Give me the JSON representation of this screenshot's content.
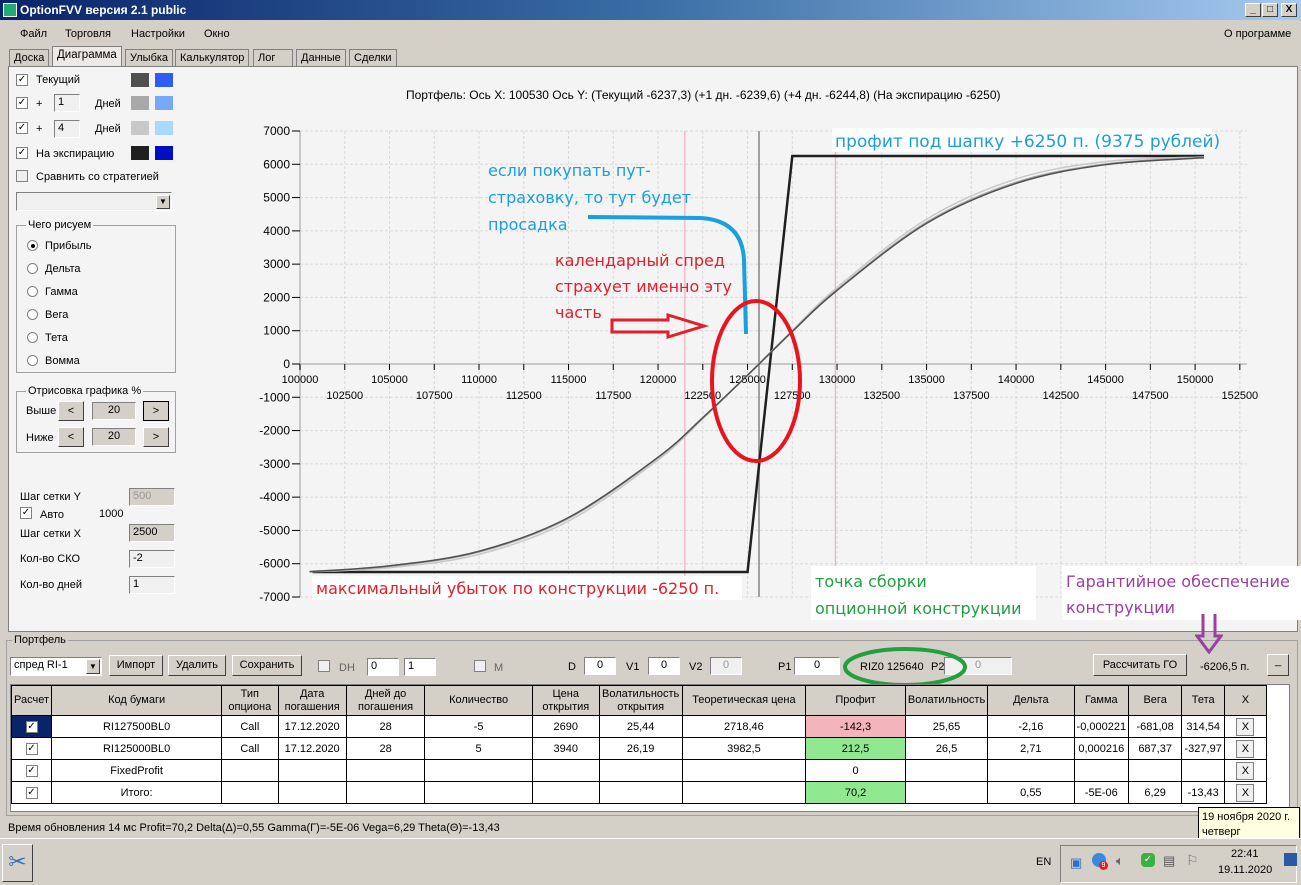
{
  "window": {
    "title": "OptionFVV версия 2.1 public",
    "controls": [
      "_",
      "□",
      "X"
    ]
  },
  "menu": {
    "items": [
      "Файл",
      "Торговля",
      "Настройки",
      "Окно"
    ],
    "about": "О программе"
  },
  "tabs": [
    "Доска",
    "Диаграмма",
    "Улыбка",
    "Калькулятор",
    "Лог",
    "Данные",
    "Сделки"
  ],
  "active_tab": "Диаграмма",
  "left": {
    "current": {
      "label": "Текущий",
      "checked": true,
      "colors": [
        "#505050",
        "#2f5cf5"
      ]
    },
    "plus1": {
      "prefix": "+",
      "value": "1",
      "unit": "Дней",
      "checked": true,
      "colors": [
        "#a8a8a8",
        "#78a8f8"
      ]
    },
    "plus4": {
      "prefix": "+",
      "value": "4",
      "unit": "Дней",
      "checked": true,
      "colors": [
        "#c8c8c8",
        "#a8d8fc"
      ]
    },
    "expiry": {
      "label": "На экспирацию",
      "checked": true,
      "colors": [
        "#202020",
        "#0010c0"
      ]
    },
    "compare": {
      "label": "Сравнить со стратегией",
      "checked": false
    },
    "strategy_select": "",
    "what_group": "Чего рисуем",
    "what_options": [
      "Прибыль",
      "Дельта",
      "Гамма",
      "Вега",
      "Тета",
      "Вомма"
    ],
    "what_selected": "Прибыль",
    "draw_group": "Отрисовка графика %",
    "above_label": "Выше",
    "above_value": "20",
    "below_label": "Ниже",
    "below_value": "20",
    "prev": "<",
    "next": ">",
    "grid_y_label": "Шаг сетки Y",
    "grid_y_value": "500",
    "auto_label": "Авто",
    "auto_checked": true,
    "auto_value": "1000",
    "grid_x_label": "Шаг сетки X",
    "grid_x_value": "2500",
    "sko_label": "Кол-во СКО",
    "sko_value": "-2",
    "days_label": "Кол-во дней",
    "days_value": "1"
  },
  "chart_header": "Портфель: Ось X: 100530 Ось Y:  (Текущий -6237,3)  (+1 дн. -6239,6)  (+4 дн. -6244,8)  (На экспирацию -6250)",
  "chart_data": {
    "type": "line",
    "xlim": [
      100000,
      152900
    ],
    "ylim": [
      -7000,
      7000
    ],
    "grid": true,
    "yticks": [
      7000,
      6000,
      5000,
      4000,
      3000,
      2000,
      1000,
      0,
      -1000,
      -2000,
      -3000,
      -4000,
      -5000,
      -6000,
      -7000
    ],
    "xticks_upper": [
      100000,
      105000,
      110000,
      115000,
      120000,
      125000,
      130000,
      135000,
      140000,
      145000,
      150000
    ],
    "xticks_lower": [
      102500,
      107500,
      112500,
      117500,
      122500,
      127500,
      132500,
      137500,
      142500,
      147500,
      152500
    ],
    "vlines": [
      {
        "x": 125640,
        "color": "#a0a0a0"
      },
      {
        "x": 121500,
        "color": "#f0a0b0"
      },
      {
        "x": 129900,
        "color": "#f0a0b0"
      }
    ],
    "x": [
      100530,
      105000,
      110000,
      115000,
      120000,
      122500,
      125000,
      127500,
      130000,
      135000,
      140000,
      145000,
      150500
    ],
    "series": [
      {
        "name": "Текущий",
        "color": "#505050",
        "values": [
          -6237,
          -6062,
          -5625,
          -4612,
          -2800,
          -1612,
          -338,
          975,
          2212,
          4225,
          5425,
          5988,
          6195
        ]
      },
      {
        "name": "+1 дн.",
        "color": "#a8a8a8",
        "values": [
          -6240,
          -6080,
          -5650,
          -4640,
          -2820,
          -1620,
          -335,
          985,
          2235,
          4260,
          5460,
          6010,
          6205
        ]
      },
      {
        "name": "+4 дн.",
        "color": "#c8c8c8",
        "values": [
          -6245,
          -6120,
          -5720,
          -4720,
          -2880,
          -1650,
          -330,
          1010,
          2300,
          4350,
          5560,
          6080,
          6220
        ]
      },
      {
        "name": "На экспирацию",
        "color": "#202020",
        "points": [
          [
            100700,
            -6250
          ],
          [
            125000,
            -6250
          ],
          [
            127500,
            6250
          ],
          [
            150500,
            6250
          ]
        ]
      }
    ]
  },
  "annotations": {
    "profit_cap": "профит под шапку +6250 п. (9375 рублей)",
    "put_lines": [
      "если покупать пут-",
      "страховку, то тут будет",
      "просадка"
    ],
    "calendar_lines": [
      "календарный спред",
      "страхует именно эту",
      "часть"
    ],
    "max_loss": "максимальный убыток по конструкции -6250 п.",
    "assembly_lines": [
      "точка сборки",
      "опционной конструкции"
    ],
    "margin_lines": [
      "Гарантийное обеспечение",
      "конструкции"
    ]
  },
  "portfolio": {
    "group": "Портфель",
    "select": "спред RI-1",
    "import": "Импорт",
    "delete": "Удалить",
    "save": "Сохранить",
    "dh_label": "DH",
    "spin1": "0",
    "spin2": "1",
    "m_label": "M",
    "d_label": "D",
    "d_value": "0",
    "v1_label": "V1",
    "v1_value": "0",
    "v2_label": "V2",
    "v2_value": "0",
    "p1_label": "P1",
    "p1_value": "0",
    "instrument": "RIZ0 125640",
    "p2_label": "P2",
    "p2_value": "0",
    "calc_go": "Рассчитать ГО",
    "go_value": "-6206,5 п.",
    "minimize": "_",
    "columns": [
      "Расчет",
      "Код бумаги",
      "Тип опциона",
      "Дата погашения",
      "Дней до погашения",
      "Количество",
      "Цена открытия",
      "Волатильность открытия",
      "Теоретическая цена",
      "Профит",
      "Волатильность",
      "Дельта",
      "Гамма",
      "Вега",
      "Тета",
      "X"
    ],
    "rows": [
      {
        "calc": true,
        "cells": [
          "RI127500BL0",
          "Call",
          "17.12.2020",
          "28",
          "-5",
          "2690",
          "25,44",
          "2718,46",
          "-142,3",
          "25,65",
          "-2,16",
          "-0,000221",
          "-681,08",
          "314,54"
        ],
        "profit_state": "neg"
      },
      {
        "calc": true,
        "cells": [
          "RI125000BL0",
          "Call",
          "17.12.2020",
          "28",
          "5",
          "3940",
          "26,19",
          "3982,5",
          "212,5",
          "26,5",
          "2,71",
          "0,000216",
          "687,37",
          "-327,97"
        ],
        "profit_state": "pos"
      },
      {
        "calc": true,
        "cells": [
          "FixedProfit",
          "",
          "",
          "",
          "",
          "",
          "",
          "",
          "0",
          "",
          "",
          "",
          "",
          ""
        ],
        "profit_state": ""
      },
      {
        "calc": true,
        "cells": [
          "Итого:",
          "",
          "",
          "",
          "",
          "",
          "",
          "",
          "70,2",
          "",
          "0,55",
          "-5E-06",
          "6,29",
          "-13,43"
        ],
        "profit_state": "pos"
      }
    ],
    "remove": "X"
  },
  "status": "Время обновления 14 мс  Profit=70,2 Delta(Δ)=0,55 Gamma(Γ)=-5E-06 Vega=6,29 Theta(Θ)=-13,43",
  "tooltip": [
    "19 ноября 2020 г.",
    "четверг"
  ],
  "taskbar": {
    "lang": "EN",
    "time": "22:41",
    "date": "19.11.2020",
    "tray_badge": "9"
  }
}
